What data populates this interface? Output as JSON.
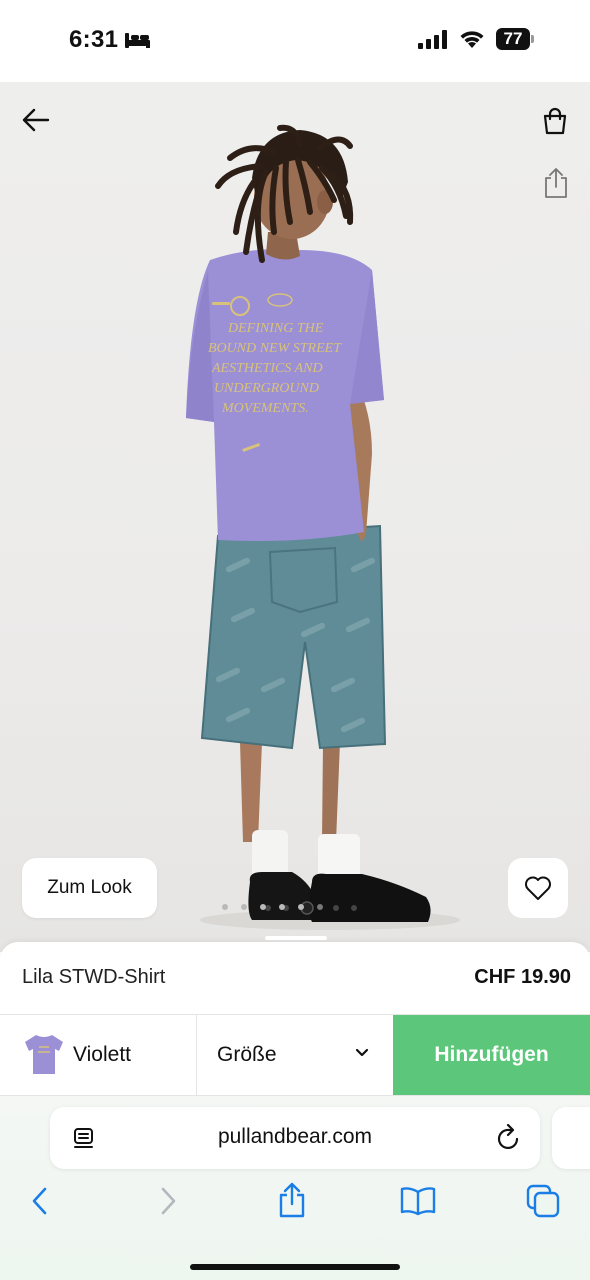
{
  "status_bar": {
    "time": "6:31",
    "battery": "77",
    "icons": [
      "sleep-mode-icon",
      "cellular-signal-icon",
      "wifi-icon",
      "battery-icon"
    ]
  },
  "hero": {
    "icons": [
      "back-arrow-icon",
      "shopping-bag-icon",
      "share-icon",
      "heart-icon"
    ],
    "look_button": "Zum Look",
    "carousel": {
      "count": 6,
      "active_index": 5
    },
    "print_lines": [
      "DEFINING THE",
      "BOUND NEW STREET",
      "AESTHETICS AND",
      "UNDERGROUND",
      "MOVEMENTS."
    ],
    "colors": {
      "shirt": "#9b8fd6",
      "denim": "#5f8c97",
      "print": "#d8c27a"
    }
  },
  "product": {
    "name": "Lila STWD-Shirt",
    "price": "CHF 19.90",
    "color_label": "Violett",
    "size_label": "Größe",
    "add_button": "Hinzufügen",
    "accent_color": "#5cc77a"
  },
  "browser": {
    "url": "pullandbear.com",
    "icons": [
      "reader-mode-icon",
      "reload-icon",
      "back-icon",
      "forward-icon",
      "share-icon",
      "bookmarks-icon",
      "tabs-icon"
    ]
  }
}
